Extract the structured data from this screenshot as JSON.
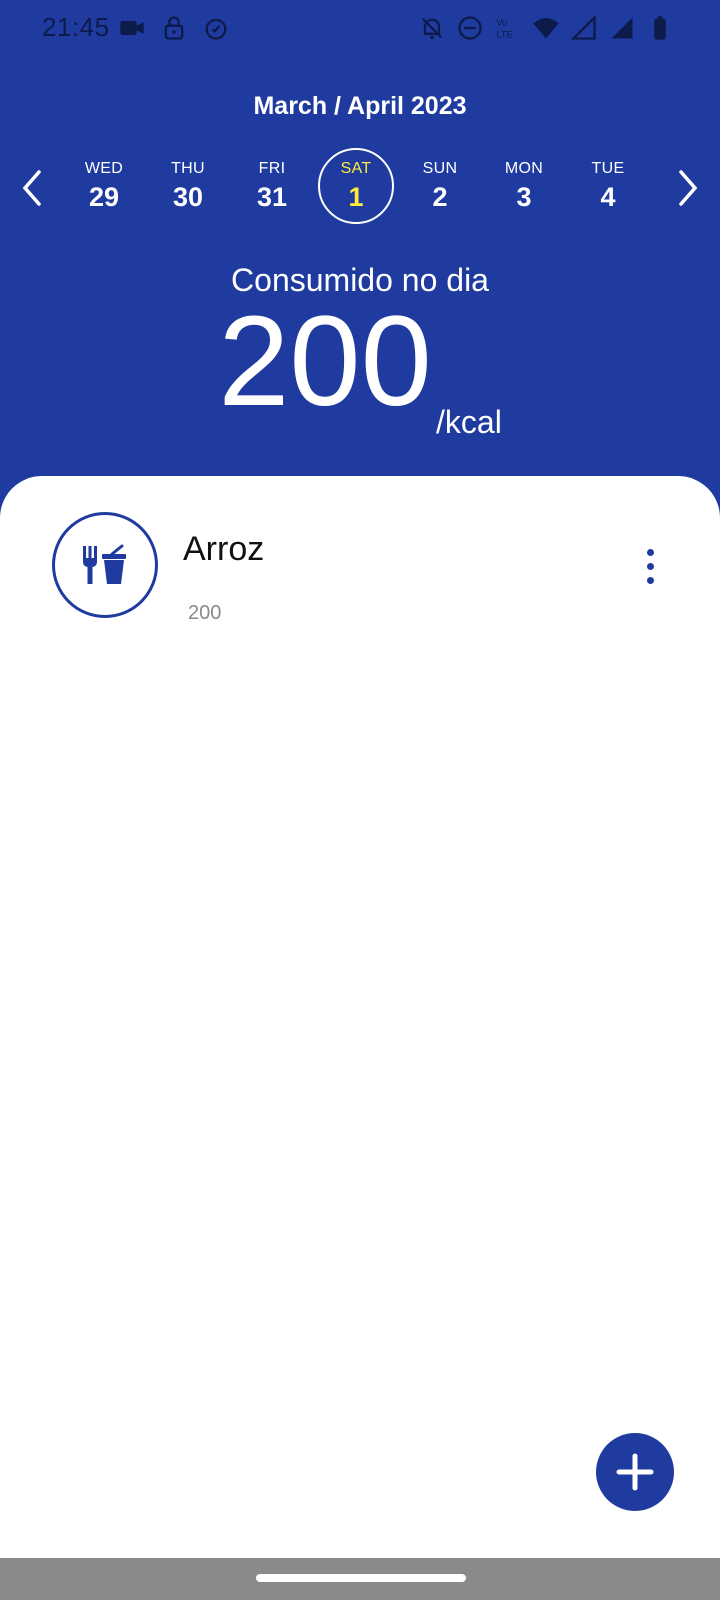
{
  "status_bar": {
    "time": "21:45",
    "left_icons": [
      "video-camera-icon",
      "lock-icon",
      "alarm-icon"
    ],
    "right_icons": [
      "bell-off-icon",
      "do-not-disturb-icon",
      "volte-icon",
      "wifi-icon",
      "signal-icon",
      "signal-icon",
      "battery-icon"
    ]
  },
  "header": {
    "month_title": "March / April 2023",
    "prev_icon": "chevron-left-icon",
    "next_icon": "chevron-right-icon",
    "days": [
      {
        "dow": "WED",
        "num": "29",
        "selected": false
      },
      {
        "dow": "THU",
        "num": "30",
        "selected": false
      },
      {
        "dow": "FRI",
        "num": "31",
        "selected": false
      },
      {
        "dow": "SAT",
        "num": "1",
        "selected": true
      },
      {
        "dow": "SUN",
        "num": "2",
        "selected": false
      },
      {
        "dow": "MON",
        "num": "3",
        "selected": false
      },
      {
        "dow": "TUE",
        "num": "4",
        "selected": false
      }
    ],
    "consumed_label": "Consumido no dia",
    "kcal_value": "200",
    "kcal_unit": "/kcal"
  },
  "food_list": [
    {
      "name": "Arroz",
      "kcal": "200",
      "icon": "fastfood-icon",
      "menu_icon": "more-vertical-icon"
    }
  ],
  "fab": {
    "icon": "plus-icon"
  },
  "colors": {
    "primary": "#1f3ba0",
    "selected_day": "#ffeb3b",
    "nav_bar": "#8a8a8a"
  }
}
